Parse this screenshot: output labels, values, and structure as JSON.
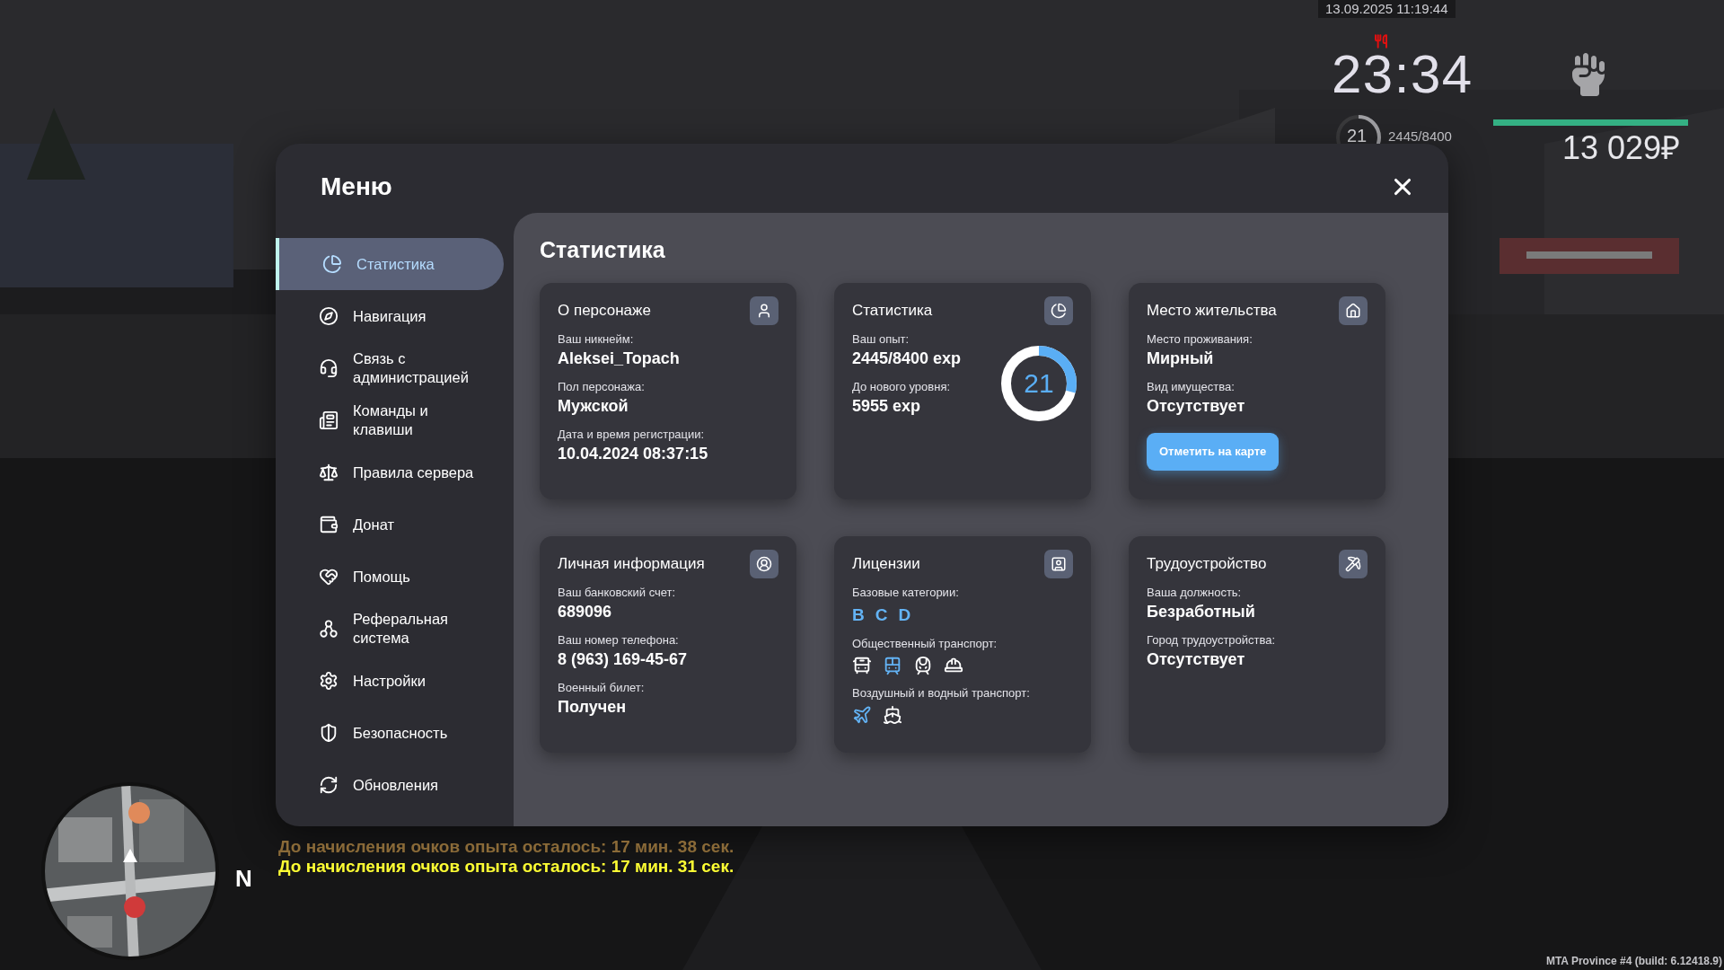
{
  "hud": {
    "datetime": "13.09.2025 11:19:44",
    "clock": "23:34",
    "level_text": "21",
    "level_ring": {
      "level": 0.3
    },
    "exp": "2445/8400",
    "health": {
      "level": 1
    },
    "money": "13 029₽"
  },
  "menu": {
    "title": "Меню",
    "sidebar": [
      {
        "label": "Статистика",
        "selected": true
      },
      {
        "label": "Навигация",
        "selected": false
      },
      {
        "label": "Связь с администрацией",
        "selected": false
      },
      {
        "label": "Команды и клавиши",
        "selected": false
      },
      {
        "label": "Правила сервера",
        "selected": false
      },
      {
        "label": "Донат",
        "selected": false
      },
      {
        "label": "Помощь",
        "selected": false
      },
      {
        "label": "Реферальная система",
        "selected": false
      },
      {
        "label": "Настройки",
        "selected": false
      },
      {
        "label": "Безопасность",
        "selected": false
      },
      {
        "label": "Обновления",
        "selected": false
      }
    ]
  },
  "page_title": "Статистика",
  "cards": [
    {
      "title": "О персонаже",
      "sections": [
        {
          "kind": "field",
          "label": "Ваш никнейм:",
          "value": "Aleksei_Topach"
        },
        {
          "kind": "field",
          "label": "Пол персонажа:",
          "value": "Мужской"
        },
        {
          "kind": "field",
          "label": "Дата и время регистрации:",
          "value": "10.04.2024 08:37:15"
        }
      ]
    },
    {
      "title": "Статистика",
      "ring": {
        "text": "21",
        "level": 0.29
      },
      "sections": [
        {
          "kind": "field",
          "label": "Ваш опыт:",
          "value": "2445/8400 exp"
        },
        {
          "kind": "field",
          "label": "До нового уровня:",
          "value": "5955 exp"
        }
      ]
    },
    {
      "title": "Место жительства",
      "button": "Отметить на карте",
      "sections": [
        {
          "kind": "field",
          "label": "Место проживания:",
          "value": "Мирный"
        },
        {
          "kind": "field",
          "label": "Вид имущества:",
          "value": "Отсутствует"
        }
      ]
    },
    {
      "title": "Личная информация",
      "sections": [
        {
          "kind": "field",
          "label": "Ваш банковский счет:",
          "value": "689096"
        },
        {
          "kind": "field",
          "label": "Ваш номер телефона:",
          "value": "8 (963) 169-45-67"
        },
        {
          "kind": "field",
          "label": "Военный билет:",
          "value": "Получен"
        }
      ]
    },
    {
      "title": "Лицензии",
      "sections": [
        {
          "kind": "categories",
          "label": "Базовые категории:",
          "items": [
            {
              "text": "B",
              "owned": true
            },
            {
              "text": "C",
              "owned": true
            },
            {
              "text": "D",
              "owned": true
            }
          ]
        },
        {
          "kind": "transport",
          "label": "Общественный транспорт:",
          "items": [
            {
              "owned": false
            },
            {
              "owned": true
            },
            {
              "owned": false
            },
            {
              "owned": false
            }
          ]
        },
        {
          "kind": "transport",
          "label": "Воздушный и водный транспорт:",
          "items": [
            {
              "owned": true
            },
            {
              "owned": false
            }
          ]
        }
      ]
    },
    {
      "title": "Трудоустройство",
      "sections": [
        {
          "kind": "field",
          "label": "Ваша должность:",
          "value": "Безработный"
        },
        {
          "kind": "field",
          "label": "Город трудоустройства:",
          "value": "Отсутствует"
        }
      ]
    }
  ],
  "chat": [
    {
      "text": "До начисления очков опыта осталось: 17 мин. 38 сек.",
      "color": "#8a6a38"
    },
    {
      "text": "До начисления очков опыта осталось: 17 мин. 31 сек.",
      "color": "#ffff33"
    }
  ],
  "minimap": {
    "north": "N"
  },
  "footer": "MTA Province #4 (build: 6.12418.9)"
}
